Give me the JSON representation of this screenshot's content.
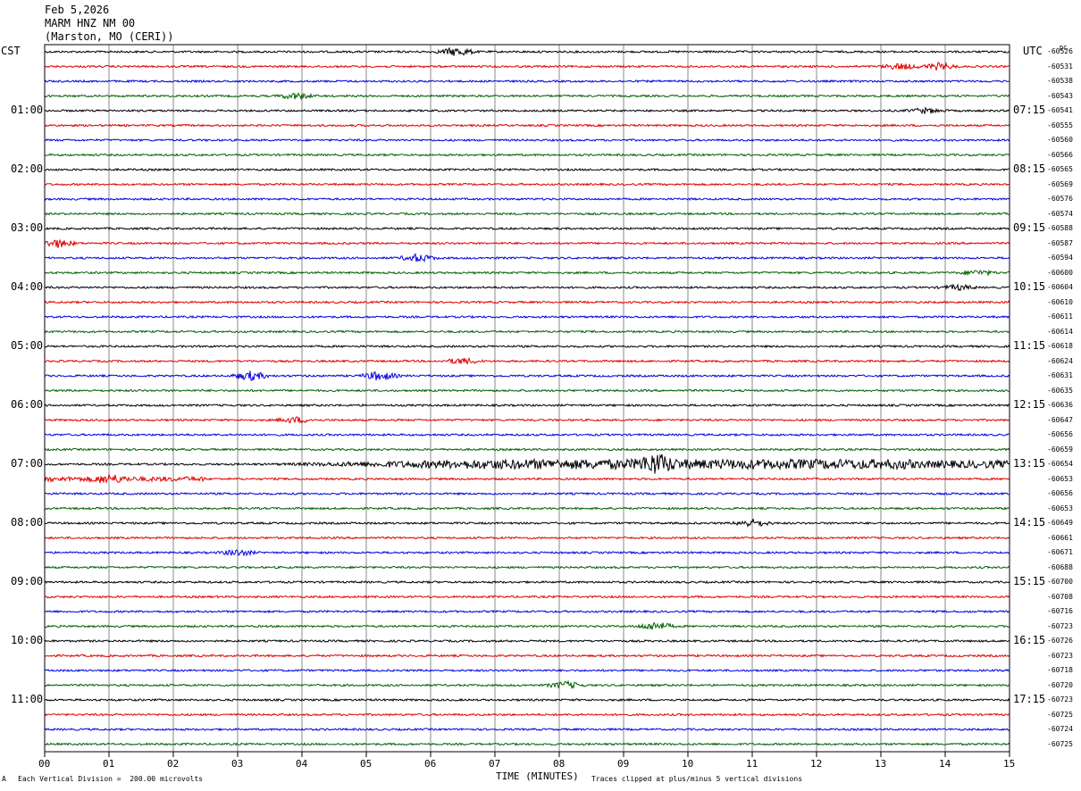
{
  "header": {
    "date": "Feb 5,2026",
    "station": "MARM HNZ NM 00",
    "location": "(Marston, MO (CERI))"
  },
  "left_axis_label": "CST",
  "right_axis_label": "UTC",
  "dc_label": "DC",
  "footer": {
    "scale_note": "Each Vertical Division =  200.00 microvolts",
    "clip_note": "Traces clipped at plus/minus 5 vertical divisions",
    "corner_mark": "A"
  },
  "trace_colors": [
    "#000000",
    "#e00000",
    "#0000e0",
    "#006000"
  ],
  "chart_data": {
    "type": "line",
    "title": "",
    "xlabel": "TIME (MINUTES)",
    "ylabel": "",
    "xlim": [
      0,
      15
    ],
    "x_ticks": [
      "00",
      "01",
      "02",
      "03",
      "04",
      "05",
      "06",
      "07",
      "08",
      "09",
      "10",
      "11",
      "12",
      "13",
      "14",
      "15"
    ],
    "rows_per_hour": 4,
    "left_hour_labels": [
      "01:00",
      "02:00",
      "03:00",
      "04:00",
      "05:00",
      "06:00",
      "07:00",
      "08:00",
      "09:00",
      "10:00",
      "11:00"
    ],
    "right_hour_labels": [
      "07:15",
      "08:15",
      "09:15",
      "10:15",
      "11:15",
      "12:15",
      "13:15",
      "14:15",
      "15:15",
      "16:15",
      "17:15"
    ],
    "dc_offsets": [
      "-60526",
      "-60531",
      "-60538",
      "-60543",
      "-60541",
      "-60555",
      "-60560",
      "-60566",
      "-60565",
      "-60569",
      "-60576",
      "-60574",
      "-60588",
      "-60587",
      "-60594",
      "-60600",
      "-60604",
      "-60610",
      "-60611",
      "-60614",
      "-60618",
      "-60624",
      "-60631",
      "-60635",
      "-60636",
      "-60647",
      "-60656",
      "-60659",
      "-60654",
      "-60653",
      "-60656",
      "-60653",
      "-60649",
      "-60661",
      "-60671",
      "-60688",
      "-60700",
      "-60708",
      "-60716",
      "-60723",
      "-60726",
      "-60723",
      "-60718",
      "-60720",
      "-60723",
      "-60725",
      "-60724",
      "-60725"
    ],
    "trace_noise_levels": [
      1,
      1,
      1,
      1,
      1,
      1,
      1,
      1,
      1,
      1,
      1,
      1,
      1,
      1,
      1,
      1,
      1,
      1,
      1,
      1,
      1,
      1,
      1,
      1,
      1,
      1,
      1,
      1,
      1,
      1,
      1,
      1,
      1,
      1,
      1,
      1,
      1,
      1,
      1,
      1,
      1,
      1,
      1,
      1,
      1,
      1,
      1,
      1
    ],
    "events": [
      {
        "trace": 0,
        "minute": 6.4,
        "amplitude": 2.2
      },
      {
        "trace": 1,
        "minute": 13.3,
        "amplitude": 1.6
      },
      {
        "trace": 1,
        "minute": 13.9,
        "amplitude": 1.8
      },
      {
        "trace": 3,
        "minute": 3.9,
        "amplitude": 1.6
      },
      {
        "trace": 4,
        "minute": 13.7,
        "amplitude": 1.3
      },
      {
        "trace": 13,
        "minute": 0.2,
        "amplitude": 2.2
      },
      {
        "trace": 14,
        "minute": 5.8,
        "amplitude": 2.0
      },
      {
        "trace": 15,
        "minute": 14.5,
        "amplitude": 1.3
      },
      {
        "trace": 16,
        "minute": 14.2,
        "amplitude": 1.3
      },
      {
        "trace": 21,
        "minute": 6.5,
        "amplitude": 1.6
      },
      {
        "trace": 22,
        "minute": 3.2,
        "amplitude": 2.4
      },
      {
        "trace": 22,
        "minute": 5.2,
        "amplitude": 2.4
      },
      {
        "trace": 25,
        "minute": 3.9,
        "amplitude": 1.6
      },
      {
        "trace": 28,
        "minute": 9.5,
        "amplitude": 4.0
      },
      {
        "trace": 29,
        "minute": 1.0,
        "amplitude": 1.8
      },
      {
        "trace": 32,
        "minute": 11.0,
        "amplitude": 2.0
      },
      {
        "trace": 34,
        "minute": 3.0,
        "amplitude": 1.6
      },
      {
        "trace": 39,
        "minute": 9.5,
        "amplitude": 2.2
      },
      {
        "trace": 43,
        "minute": 8.1,
        "amplitude": 1.8
      }
    ],
    "grid": "vertical-minute-lines"
  }
}
